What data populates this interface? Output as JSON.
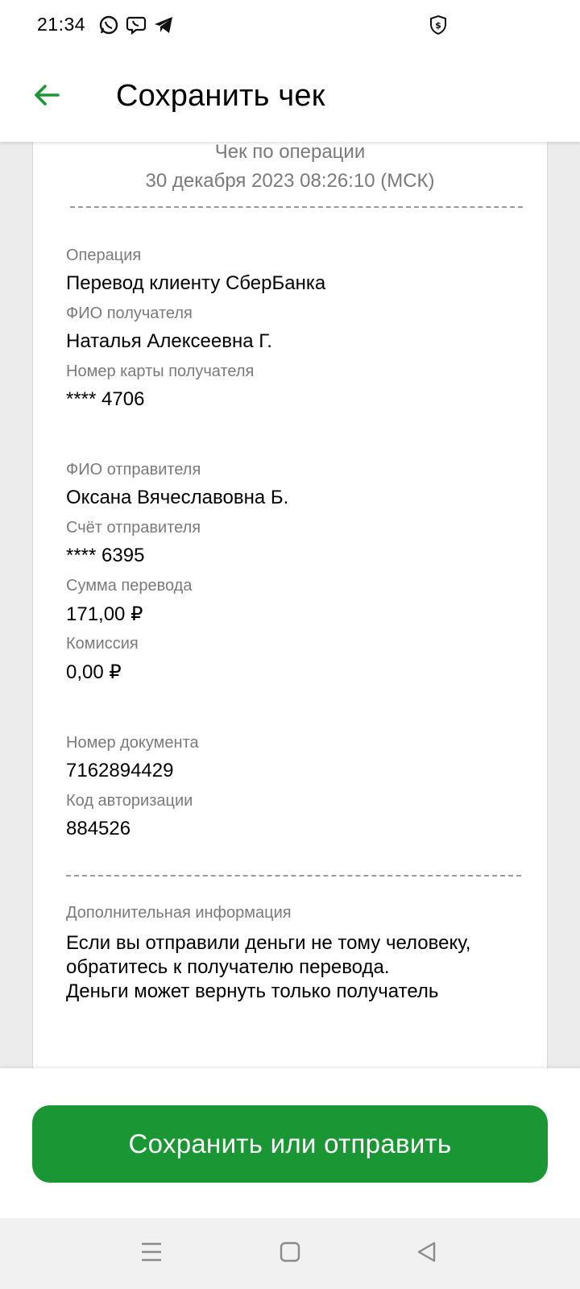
{
  "status_bar": {
    "time": "21:34",
    "icons": [
      "whatsapp-icon",
      "viber-icon",
      "telegram-icon",
      "shield-dollar-icon"
    ]
  },
  "app_bar": {
    "title": "Сохранить чек",
    "back_icon": "arrow-left-icon",
    "accent_color": "#1a9634"
  },
  "receipt": {
    "header_title": "Чек по операции",
    "header_date": "30 декабря 2023 08:26:10 (МСК)",
    "section1": [
      {
        "label": "Операция",
        "value": "Перевод клиенту СберБанка"
      },
      {
        "label": "ФИО получателя",
        "value": "Наталья Алексеевна Г."
      },
      {
        "label": "Номер карты получателя",
        "value": "**** 4706"
      }
    ],
    "section2": [
      {
        "label": "ФИО отправителя",
        "value": "Оксана Вячеславовна Б."
      },
      {
        "label": "Счёт отправителя",
        "value": "**** 6395"
      },
      {
        "label": "Сумма перевода",
        "value": "171,00 ₽"
      },
      {
        "label": "Комиссия",
        "value": "0,00 ₽"
      }
    ],
    "section3": [
      {
        "label": "Номер документа",
        "value": "7162894429"
      },
      {
        "label": "Код авторизации",
        "value": "884526"
      }
    ],
    "extra_label": "Дополнительная информация",
    "extra_lines": [
      "Если вы отправили деньги не тому человеку,",
      "обратитесь к получателю перевода.",
      "Деньги может вернуть только получатель"
    ]
  },
  "bottom": {
    "save_button_label": "Сохранить или отправить",
    "button_color": "#1a9634"
  },
  "nav_bar": {
    "icons": [
      "menu-icon",
      "home-square-icon",
      "back-triangle-icon"
    ]
  }
}
